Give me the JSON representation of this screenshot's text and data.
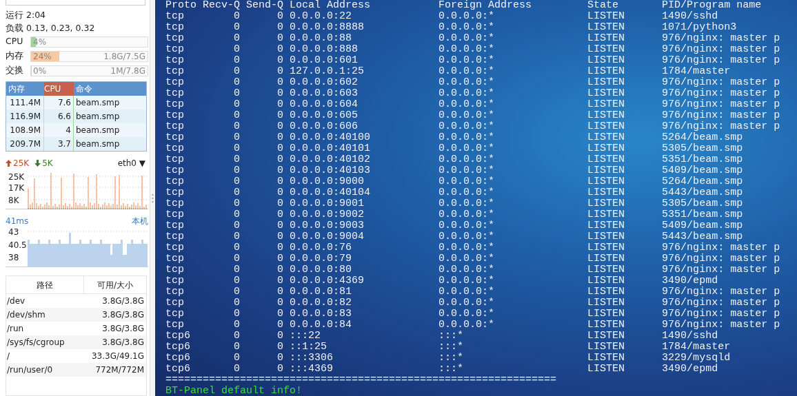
{
  "sysinfo": {
    "uptime": "运行 2:04",
    "load": "负载 0.13, 0.23, 0.32"
  },
  "meters": [
    {
      "label": "CPU",
      "percent": "4%",
      "level": 0.04,
      "color": "#9fd39a"
    },
    {
      "label": "内存",
      "percent": "24%",
      "reading": "1.8G/7.5G",
      "level": 0.24,
      "color": "#f7c9a5"
    },
    {
      "label": "交换",
      "percent": "0%",
      "reading": "1M/7.8G",
      "level": 0.0
    }
  ],
  "processes": {
    "columns": [
      {
        "label": "内存",
        "selected": false
      },
      {
        "label": "CPU",
        "selected": true
      },
      {
        "label": "命令",
        "selected": false
      }
    ],
    "rows": [
      [
        "111.4M",
        "7.6",
        "beam.smp"
      ],
      [
        "116.9M",
        "6.6",
        "beam.smp"
      ],
      [
        "108.9M",
        "4",
        "beam.smp"
      ],
      [
        "209.7M",
        "3.7",
        "beam.smp"
      ]
    ]
  },
  "network": {
    "up": "25K",
    "down": "5K",
    "interface": "eth0",
    "dropdown": "▼",
    "yticks": [
      "25K",
      "17K",
      "8K"
    ]
  },
  "ping": {
    "latency": "41ms",
    "host": "本机",
    "yticks": [
      "43",
      "40.5",
      "38"
    ]
  },
  "disks": {
    "columns": [
      "路径",
      "可用/大小"
    ],
    "rows": [
      [
        "/dev",
        "3.8G/3.8G"
      ],
      [
        "/dev/shm",
        "3.8G/3.8G"
      ],
      [
        "/run",
        "3.8G/3.8G"
      ],
      [
        "/sys/fs/cgroup",
        "3.8G/3.8G"
      ],
      [
        "/",
        "33.3G/49.1G"
      ],
      [
        "/run/user/0",
        "772M/772M"
      ]
    ]
  },
  "terminal": {
    "header": [
      "Proto",
      "Recv-Q",
      "Send-Q",
      "Local Address",
      "Foreign Address",
      "State",
      "PID/Program name"
    ],
    "rows": [
      [
        "tcp",
        "0",
        "0",
        "0.0.0.0:22",
        "0.0.0.0:*",
        "LISTEN",
        "1490/sshd"
      ],
      [
        "tcp",
        "0",
        "0",
        "0.0.0.0:8888",
        "0.0.0.0:*",
        "LISTEN",
        "1071/python3"
      ],
      [
        "tcp",
        "0",
        "0",
        "0.0.0.0:88",
        "0.0.0.0:*",
        "LISTEN",
        "976/nginx: master p"
      ],
      [
        "tcp",
        "0",
        "0",
        "0.0.0.0:888",
        "0.0.0.0:*",
        "LISTEN",
        "976/nginx: master p"
      ],
      [
        "tcp",
        "0",
        "0",
        "0.0.0.0:601",
        "0.0.0.0:*",
        "LISTEN",
        "976/nginx: master p"
      ],
      [
        "tcp",
        "0",
        "0",
        "127.0.0.1:25",
        "0.0.0.0:*",
        "LISTEN",
        "1784/master"
      ],
      [
        "tcp",
        "0",
        "0",
        "0.0.0.0:602",
        "0.0.0.0:*",
        "LISTEN",
        "976/nginx: master p"
      ],
      [
        "tcp",
        "0",
        "0",
        "0.0.0.0:603",
        "0.0.0.0:*",
        "LISTEN",
        "976/nginx: master p"
      ],
      [
        "tcp",
        "0",
        "0",
        "0.0.0.0:604",
        "0.0.0.0:*",
        "LISTEN",
        "976/nginx: master p"
      ],
      [
        "tcp",
        "0",
        "0",
        "0.0.0.0:605",
        "0.0.0.0:*",
        "LISTEN",
        "976/nginx: master p"
      ],
      [
        "tcp",
        "0",
        "0",
        "0.0.0.0:606",
        "0.0.0.0:*",
        "LISTEN",
        "976/nginx: master p"
      ],
      [
        "tcp",
        "0",
        "0",
        "0.0.0.0:40100",
        "0.0.0.0:*",
        "LISTEN",
        "5264/beam.smp"
      ],
      [
        "tcp",
        "0",
        "0",
        "0.0.0.0:40101",
        "0.0.0.0:*",
        "LISTEN",
        "5305/beam.smp"
      ],
      [
        "tcp",
        "0",
        "0",
        "0.0.0.0:40102",
        "0.0.0.0:*",
        "LISTEN",
        "5351/beam.smp"
      ],
      [
        "tcp",
        "0",
        "0",
        "0.0.0.0:40103",
        "0.0.0.0:*",
        "LISTEN",
        "5409/beam.smp"
      ],
      [
        "tcp",
        "0",
        "0",
        "0.0.0.0:9000",
        "0.0.0.0:*",
        "LISTEN",
        "5264/beam.smp"
      ],
      [
        "tcp",
        "0",
        "0",
        "0.0.0.0:40104",
        "0.0.0.0:*",
        "LISTEN",
        "5443/beam.smp"
      ],
      [
        "tcp",
        "0",
        "0",
        "0.0.0.0:9001",
        "0.0.0.0:*",
        "LISTEN",
        "5305/beam.smp"
      ],
      [
        "tcp",
        "0",
        "0",
        "0.0.0.0:9002",
        "0.0.0.0:*",
        "LISTEN",
        "5351/beam.smp"
      ],
      [
        "tcp",
        "0",
        "0",
        "0.0.0.0:9003",
        "0.0.0.0:*",
        "LISTEN",
        "5409/beam.smp"
      ],
      [
        "tcp",
        "0",
        "0",
        "0.0.0.0:9004",
        "0.0.0.0:*",
        "LISTEN",
        "5443/beam.smp"
      ],
      [
        "tcp",
        "0",
        "0",
        "0.0.0.0:76",
        "0.0.0.0:*",
        "LISTEN",
        "976/nginx: master p"
      ],
      [
        "tcp",
        "0",
        "0",
        "0.0.0.0:79",
        "0.0.0.0:*",
        "LISTEN",
        "976/nginx: master p"
      ],
      [
        "tcp",
        "0",
        "0",
        "0.0.0.0:80",
        "0.0.0.0:*",
        "LISTEN",
        "976/nginx: master p"
      ],
      [
        "tcp",
        "0",
        "0",
        "0.0.0.0:4369",
        "0.0.0.0:*",
        "LISTEN",
        "3490/epmd"
      ],
      [
        "tcp",
        "0",
        "0",
        "0.0.0.0:81",
        "0.0.0.0:*",
        "LISTEN",
        "976/nginx: master p"
      ],
      [
        "tcp",
        "0",
        "0",
        "0.0.0.0:82",
        "0.0.0.0:*",
        "LISTEN",
        "976/nginx: master p"
      ],
      [
        "tcp",
        "0",
        "0",
        "0.0.0.0:83",
        "0.0.0.0:*",
        "LISTEN",
        "976/nginx: master p"
      ],
      [
        "tcp",
        "0",
        "0",
        "0.0.0.0:84",
        "0.0.0.0:*",
        "LISTEN",
        "976/nginx: master p"
      ],
      [
        "tcp6",
        "0",
        "0",
        ":::22",
        ":::*",
        "LISTEN",
        "1490/sshd"
      ],
      [
        "tcp6",
        "0",
        "0",
        "::1:25",
        ":::*",
        "LISTEN",
        "1784/master"
      ],
      [
        "tcp6",
        "0",
        "0",
        ":::3306",
        ":::*",
        "LISTEN",
        "3229/mysqld"
      ],
      [
        "tcp6",
        "0",
        "0",
        ":::4369",
        ":::*",
        "LISTEN",
        "3490/epmd"
      ]
    ],
    "separator": "===============================================================",
    "notice": "BT-Panel default info!"
  }
}
